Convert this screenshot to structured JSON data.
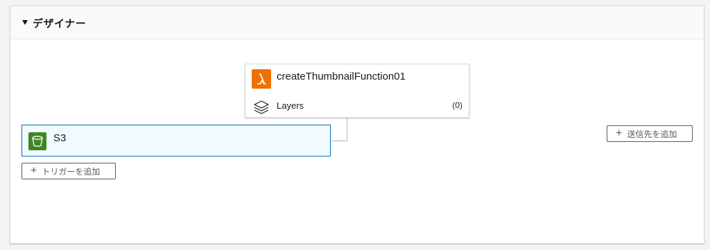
{
  "designer": {
    "title": "デザイナー"
  },
  "function": {
    "name": "createThumbnailFunction01",
    "layers_label": "Layers",
    "layers_count": "(0)"
  },
  "trigger": {
    "name": "S3",
    "add_label": "トリガーを追加"
  },
  "destination": {
    "add_label": "送信先を追加"
  },
  "colors": {
    "lambda": "#ed7100",
    "s3": "#3f8624",
    "selected_border": "#0073bb",
    "selected_bg": "#f1faff"
  },
  "icons": {
    "collapse": "caret-down-icon",
    "function": "lambda-icon",
    "layers": "layers-icon",
    "trigger": "s3-bucket-icon",
    "add": "plus-icon"
  }
}
